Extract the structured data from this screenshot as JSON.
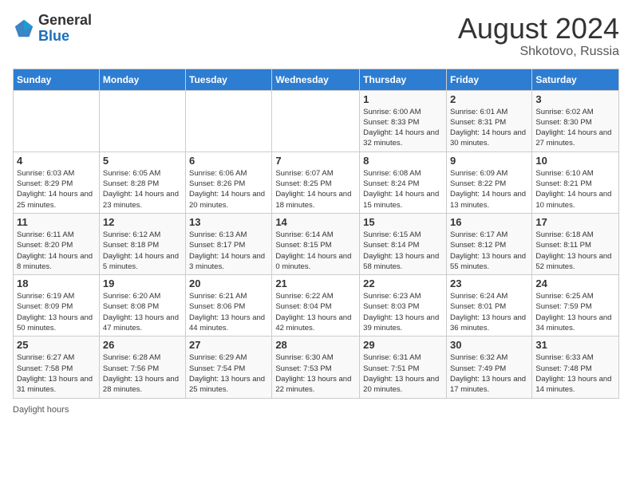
{
  "header": {
    "logo_general": "General",
    "logo_blue": "Blue",
    "month_year": "August 2024",
    "location": "Shkotovo, Russia"
  },
  "days_of_week": [
    "Sunday",
    "Monday",
    "Tuesday",
    "Wednesday",
    "Thursday",
    "Friday",
    "Saturday"
  ],
  "legend": {
    "daylight_hours": "Daylight hours"
  },
  "weeks": [
    [
      {
        "day": "",
        "info": ""
      },
      {
        "day": "",
        "info": ""
      },
      {
        "day": "",
        "info": ""
      },
      {
        "day": "",
        "info": ""
      },
      {
        "day": "1",
        "sunrise": "Sunrise: 6:00 AM",
        "sunset": "Sunset: 8:33 PM",
        "daylight": "Daylight: 14 hours and 32 minutes."
      },
      {
        "day": "2",
        "sunrise": "Sunrise: 6:01 AM",
        "sunset": "Sunset: 8:31 PM",
        "daylight": "Daylight: 14 hours and 30 minutes."
      },
      {
        "day": "3",
        "sunrise": "Sunrise: 6:02 AM",
        "sunset": "Sunset: 8:30 PM",
        "daylight": "Daylight: 14 hours and 27 minutes."
      }
    ],
    [
      {
        "day": "4",
        "sunrise": "Sunrise: 6:03 AM",
        "sunset": "Sunset: 8:29 PM",
        "daylight": "Daylight: 14 hours and 25 minutes."
      },
      {
        "day": "5",
        "sunrise": "Sunrise: 6:05 AM",
        "sunset": "Sunset: 8:28 PM",
        "daylight": "Daylight: 14 hours and 23 minutes."
      },
      {
        "day": "6",
        "sunrise": "Sunrise: 6:06 AM",
        "sunset": "Sunset: 8:26 PM",
        "daylight": "Daylight: 14 hours and 20 minutes."
      },
      {
        "day": "7",
        "sunrise": "Sunrise: 6:07 AM",
        "sunset": "Sunset: 8:25 PM",
        "daylight": "Daylight: 14 hours and 18 minutes."
      },
      {
        "day": "8",
        "sunrise": "Sunrise: 6:08 AM",
        "sunset": "Sunset: 8:24 PM",
        "daylight": "Daylight: 14 hours and 15 minutes."
      },
      {
        "day": "9",
        "sunrise": "Sunrise: 6:09 AM",
        "sunset": "Sunset: 8:22 PM",
        "daylight": "Daylight: 14 hours and 13 minutes."
      },
      {
        "day": "10",
        "sunrise": "Sunrise: 6:10 AM",
        "sunset": "Sunset: 8:21 PM",
        "daylight": "Daylight: 14 hours and 10 minutes."
      }
    ],
    [
      {
        "day": "11",
        "sunrise": "Sunrise: 6:11 AM",
        "sunset": "Sunset: 8:20 PM",
        "daylight": "Daylight: 14 hours and 8 minutes."
      },
      {
        "day": "12",
        "sunrise": "Sunrise: 6:12 AM",
        "sunset": "Sunset: 8:18 PM",
        "daylight": "Daylight: 14 hours and 5 minutes."
      },
      {
        "day": "13",
        "sunrise": "Sunrise: 6:13 AM",
        "sunset": "Sunset: 8:17 PM",
        "daylight": "Daylight: 14 hours and 3 minutes."
      },
      {
        "day": "14",
        "sunrise": "Sunrise: 6:14 AM",
        "sunset": "Sunset: 8:15 PM",
        "daylight": "Daylight: 14 hours and 0 minutes."
      },
      {
        "day": "15",
        "sunrise": "Sunrise: 6:15 AM",
        "sunset": "Sunset: 8:14 PM",
        "daylight": "Daylight: 13 hours and 58 minutes."
      },
      {
        "day": "16",
        "sunrise": "Sunrise: 6:17 AM",
        "sunset": "Sunset: 8:12 PM",
        "daylight": "Daylight: 13 hours and 55 minutes."
      },
      {
        "day": "17",
        "sunrise": "Sunrise: 6:18 AM",
        "sunset": "Sunset: 8:11 PM",
        "daylight": "Daylight: 13 hours and 52 minutes."
      }
    ],
    [
      {
        "day": "18",
        "sunrise": "Sunrise: 6:19 AM",
        "sunset": "Sunset: 8:09 PM",
        "daylight": "Daylight: 13 hours and 50 minutes."
      },
      {
        "day": "19",
        "sunrise": "Sunrise: 6:20 AM",
        "sunset": "Sunset: 8:08 PM",
        "daylight": "Daylight: 13 hours and 47 minutes."
      },
      {
        "day": "20",
        "sunrise": "Sunrise: 6:21 AM",
        "sunset": "Sunset: 8:06 PM",
        "daylight": "Daylight: 13 hours and 44 minutes."
      },
      {
        "day": "21",
        "sunrise": "Sunrise: 6:22 AM",
        "sunset": "Sunset: 8:04 PM",
        "daylight": "Daylight: 13 hours and 42 minutes."
      },
      {
        "day": "22",
        "sunrise": "Sunrise: 6:23 AM",
        "sunset": "Sunset: 8:03 PM",
        "daylight": "Daylight: 13 hours and 39 minutes."
      },
      {
        "day": "23",
        "sunrise": "Sunrise: 6:24 AM",
        "sunset": "Sunset: 8:01 PM",
        "daylight": "Daylight: 13 hours and 36 minutes."
      },
      {
        "day": "24",
        "sunrise": "Sunrise: 6:25 AM",
        "sunset": "Sunset: 7:59 PM",
        "daylight": "Daylight: 13 hours and 34 minutes."
      }
    ],
    [
      {
        "day": "25",
        "sunrise": "Sunrise: 6:27 AM",
        "sunset": "Sunset: 7:58 PM",
        "daylight": "Daylight: 13 hours and 31 minutes."
      },
      {
        "day": "26",
        "sunrise": "Sunrise: 6:28 AM",
        "sunset": "Sunset: 7:56 PM",
        "daylight": "Daylight: 13 hours and 28 minutes."
      },
      {
        "day": "27",
        "sunrise": "Sunrise: 6:29 AM",
        "sunset": "Sunset: 7:54 PM",
        "daylight": "Daylight: 13 hours and 25 minutes."
      },
      {
        "day": "28",
        "sunrise": "Sunrise: 6:30 AM",
        "sunset": "Sunset: 7:53 PM",
        "daylight": "Daylight: 13 hours and 22 minutes."
      },
      {
        "day": "29",
        "sunrise": "Sunrise: 6:31 AM",
        "sunset": "Sunset: 7:51 PM",
        "daylight": "Daylight: 13 hours and 20 minutes."
      },
      {
        "day": "30",
        "sunrise": "Sunrise: 6:32 AM",
        "sunset": "Sunset: 7:49 PM",
        "daylight": "Daylight: 13 hours and 17 minutes."
      },
      {
        "day": "31",
        "sunrise": "Sunrise: 6:33 AM",
        "sunset": "Sunset: 7:48 PM",
        "daylight": "Daylight: 13 hours and 14 minutes."
      }
    ]
  ]
}
